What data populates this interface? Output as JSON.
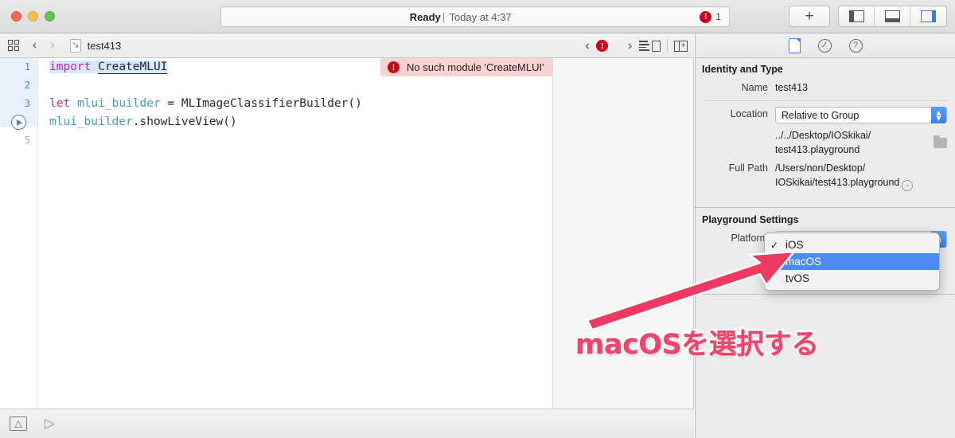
{
  "window": {
    "traffic_lights": [
      "close",
      "minimize",
      "zoom"
    ],
    "status": {
      "state": "Ready",
      "separator": "|",
      "detail": "Today at 4:37",
      "error_count": "1",
      "error_icon": "error-circle-icon"
    },
    "toolbar_right": {
      "add_label": "+",
      "layout_buttons": [
        "navigator-toggle",
        "debug-area-toggle",
        "inspector-toggle"
      ]
    }
  },
  "jumpbar": {
    "grid_icon": "related-items-icon",
    "back_icon": "chevron-left-icon",
    "forward_icon": "chevron-right-icon",
    "file_icon": "swift-playground-file-icon",
    "filename": "test413",
    "issue_prev_icon": "chevron-left-icon",
    "issue_badge": "!",
    "issue_next_icon": "chevron-right-icon",
    "jump_assistant_icon": "editor-options-icon",
    "assistant_icon": "assistant-editor-icon"
  },
  "editor": {
    "lines": [
      {
        "number": "1",
        "active": true,
        "is_run": false
      },
      {
        "number": "2",
        "active": true,
        "is_run": false
      },
      {
        "number": "3",
        "active": true,
        "is_run": false
      },
      {
        "number": "4",
        "active": true,
        "is_run": true
      },
      {
        "number": "5",
        "active": false,
        "is_run": false
      }
    ],
    "code": {
      "line1_keyword": "import",
      "line1_module": "CreateMLUI",
      "line3_keyword": "let",
      "line3_var": "mlui_builder",
      "line3_rest": " = MLImageClassifierBuilder()",
      "line4_var": "mlui_builder",
      "line4_rest": ".showLiveView()"
    },
    "error_banner": {
      "icon": "error-circle-icon",
      "message": "No such module 'CreateMLUI'"
    }
  },
  "bottombar": {
    "show_console_icon": "show-console-icon",
    "run_icon": "run-playground-icon"
  },
  "inspector": {
    "tabs": [
      {
        "name": "file-inspector",
        "icon": "file-icon",
        "selected": true
      },
      {
        "name": "history-inspector",
        "icon": "clock-icon",
        "selected": false
      },
      {
        "name": "quick-help-inspector",
        "icon": "question-icon",
        "selected": false
      }
    ],
    "identity_section": {
      "title": "Identity and Type",
      "name_label": "Name",
      "name_value": "test413",
      "location_label": "Location",
      "location_value": "Relative to Group",
      "relative_path_line1": "../../Desktop/IOSkikai/",
      "relative_path_line2": "test413.playground",
      "folder_icon": "folder-icon",
      "full_path_label": "Full Path",
      "full_path_line1": "/Users/non/Desktop/",
      "full_path_line2": "IOSkikai/test413.playground",
      "reveal_icon": "reveal-in-finder-icon"
    },
    "playground_section": {
      "title": "Playground Settings",
      "platform_label": "Platform"
    }
  },
  "dropdown": {
    "name": "platform-popup-menu",
    "items": [
      {
        "label": "iOS",
        "checked": true,
        "selected": false
      },
      {
        "label": "macOS",
        "checked": false,
        "selected": true
      },
      {
        "label": "tvOS",
        "checked": false,
        "selected": false
      }
    ],
    "check_glyph": "✓"
  },
  "annotation": {
    "text": "macOSを選択する",
    "arrow_color": "#ec3a63",
    "text_color": "#f0456b"
  }
}
